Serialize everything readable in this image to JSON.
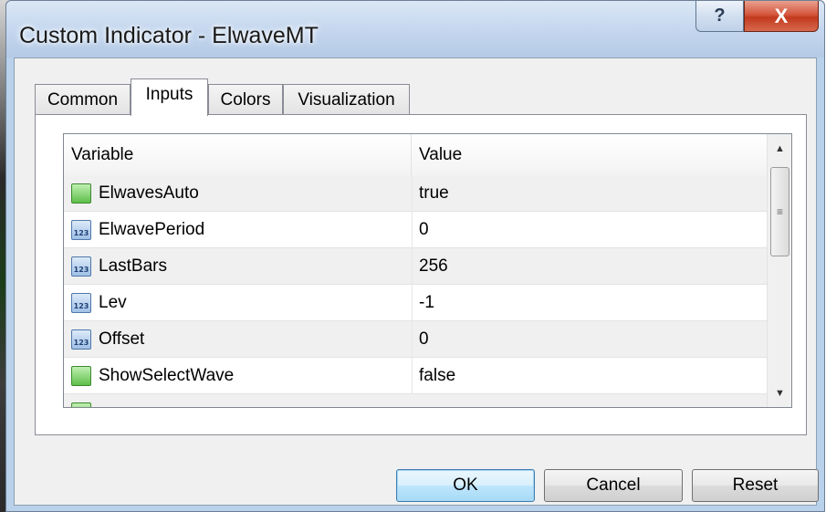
{
  "window": {
    "title": "Custom Indicator - ElwaveMT",
    "help_glyph": "?",
    "close_glyph": "X"
  },
  "tabs": [
    {
      "label": "Common",
      "active": false
    },
    {
      "label": "Inputs",
      "active": true
    },
    {
      "label": "Colors",
      "active": false
    },
    {
      "label": "Visualization",
      "active": false
    }
  ],
  "table": {
    "columns": [
      "Variable",
      "Value"
    ],
    "rows": [
      {
        "name": "ElwavesAuto",
        "value": "true",
        "icon": "bool-icon"
      },
      {
        "name": "ElwavePeriod",
        "value": "0",
        "icon": "number-icon"
      },
      {
        "name": "LastBars",
        "value": "256",
        "icon": "number-icon"
      },
      {
        "name": "Lev",
        "value": "-1",
        "icon": "number-icon"
      },
      {
        "name": "Offset",
        "value": "0",
        "icon": "number-icon"
      },
      {
        "name": "ShowSelectWave",
        "value": "false",
        "icon": "bool-icon"
      }
    ],
    "number_icon_text": "123"
  },
  "buttons": {
    "ok": "OK",
    "cancel": "Cancel",
    "reset": "Reset"
  },
  "colors": {
    "title_bar": "#c3d6ee",
    "close_button": "#d4573d",
    "bool_icon": "#5fbf4a",
    "number_icon": "#9fc0e6",
    "default_button": "#bee6fd"
  }
}
